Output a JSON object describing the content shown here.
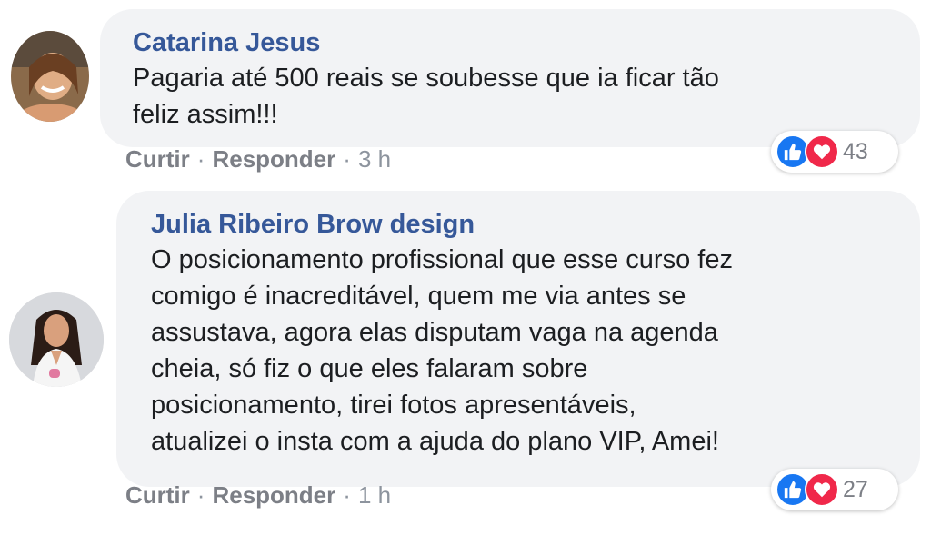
{
  "comments": [
    {
      "author": "Catarina Jesus",
      "text_lines": [
        "Pagaria até 500 reais se soubesse que ia ficar tão",
        "feliz assim!!!"
      ],
      "actions": {
        "like": "Curtir",
        "reply": "Responder",
        "separator": "·",
        "time": "3 h"
      },
      "reactions": {
        "count": "43",
        "icons": [
          "like-icon",
          "love-icon"
        ]
      },
      "colors": {
        "like": "#1877f2",
        "love": "#f0284a"
      }
    },
    {
      "author": "Julia Ribeiro Brow design",
      "text_lines": [
        "O posicionamento profissional que esse curso fez",
        "comigo é inacreditável, quem me via antes se",
        "assustava, agora elas disputam vaga na agenda",
        "cheia, só fiz o que eles falaram sobre",
        "posicionamento, tirei fotos apresentáveis,",
        "atualizei o insta com a ajuda do plano VIP, Amei!"
      ],
      "actions": {
        "like": "Curtir",
        "reply": "Responder",
        "separator": "·",
        "time": "1 h"
      },
      "reactions": {
        "count": "27",
        "icons": [
          "like-icon",
          "love-icon"
        ]
      },
      "colors": {
        "like": "#1877f2",
        "love": "#f0284a"
      }
    }
  ],
  "theme": {
    "author_color": "#365899",
    "bubble_bg": "#f2f3f5",
    "text_color": "#1c1e21",
    "meta_color": "#7c7f86"
  }
}
